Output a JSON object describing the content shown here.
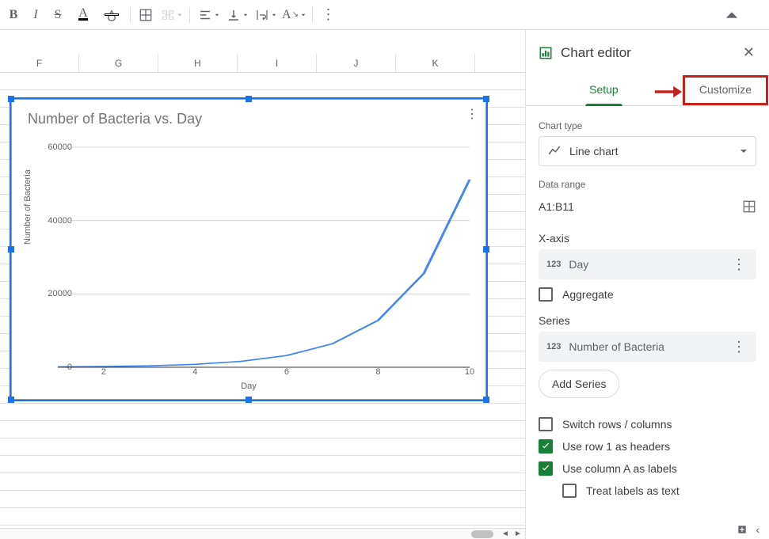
{
  "columns": [
    "F",
    "G",
    "H",
    "I",
    "J",
    "K"
  ],
  "panel": {
    "title": "Chart editor",
    "tab_setup": "Setup",
    "tab_customize": "Customize",
    "chart_type_label": "Chart type",
    "chart_type_value": "Line chart",
    "data_range_label": "Data range",
    "data_range_value": "A1:B11",
    "xaxis_label": "X-axis",
    "xaxis_field": "Day",
    "aggregate_label": "Aggregate",
    "series_label": "Series",
    "series_field": "Number of Bacteria",
    "add_series": "Add Series",
    "switch_label": "Switch rows / columns",
    "headers_label": "Use row 1 as headers",
    "labels_label": "Use column A as labels",
    "treat_label": "Treat labels as text"
  },
  "chart": {
    "title": "Number of Bacteria vs. Day",
    "xlabel": "Day",
    "ylabel": "Number of Bacteria"
  },
  "chart_data": {
    "type": "line",
    "title": "Number of Bacteria vs. Day",
    "xlabel": "Day",
    "ylabel": "Number of Bacteria",
    "x": [
      1,
      2,
      3,
      4,
      5,
      6,
      7,
      8,
      9,
      10
    ],
    "values": [
      100,
      200,
      400,
      800,
      1600,
      3200,
      6400,
      12800,
      25600,
      51200
    ],
    "ylim": [
      0,
      60000
    ],
    "yticks": [
      0,
      20000,
      40000,
      60000
    ],
    "xticks": [
      2,
      4,
      6,
      8,
      10
    ]
  }
}
